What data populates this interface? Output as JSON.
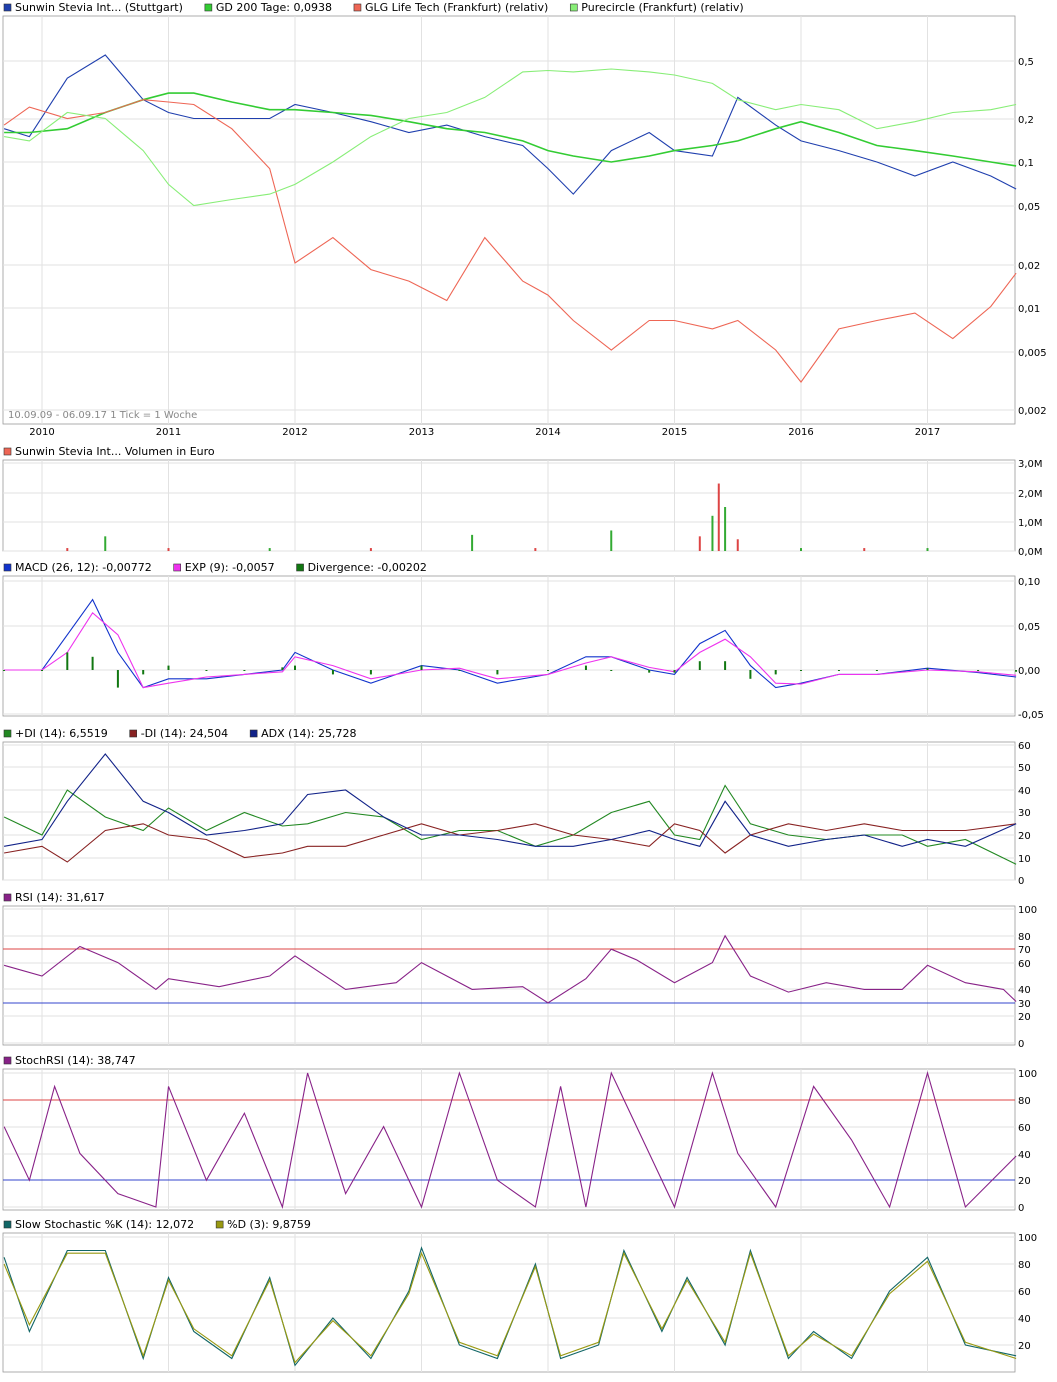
{
  "x_years": [
    "2010",
    "2011",
    "2012",
    "2013",
    "2014",
    "2015",
    "2016",
    "2017"
  ],
  "range_note": "10.09.09 - 06.09.17   1 Tick = 1 Woche",
  "colors": {
    "sunwin": "#1f3fae",
    "gd200": "#33cc33",
    "glg": "#ee6655",
    "pure": "#88ee77",
    "vol": "#dd4444",
    "vol_green": "#33aa33",
    "macd": "#1133cc",
    "exp": "#ee33ee",
    "div": "#117711",
    "pdi": "#228822",
    "mdi": "#882222",
    "adx": "#112288",
    "rsi": "#882288",
    "stoch_k": "#116666",
    "stoch_d": "#999911",
    "line_high": "#dd4444",
    "line_low": "#3344cc",
    "fill_high": "#ee5566",
    "fill_low": "#5555ee"
  },
  "panels": [
    {
      "id": "price",
      "legend": [
        {
          "label": "Sunwin Stevia Int... (Stuttgart)",
          "color": "#1f3fae"
        },
        {
          "label": "GD 200 Tage: 0,0938",
          "color": "#33cc33"
        },
        {
          "label": "GLG Life Tech (Frankfurt) (relativ)",
          "color": "#ee6655"
        },
        {
          "label": "Purecircle (Frankfurt) (relativ)",
          "color": "#88ee77"
        }
      ],
      "ticks": [
        "0,5",
        "0,2",
        "0,1",
        "0,05",
        "0,02",
        "0,01",
        "0,005",
        "0,002"
      ]
    },
    {
      "id": "volume",
      "legend": [
        {
          "label": "Sunwin Stevia Int... Volumen in Euro",
          "color": "#ee6655"
        }
      ],
      "ticks": [
        "3,0M",
        "2,0M",
        "1,0M",
        "0,0M"
      ]
    },
    {
      "id": "macd",
      "legend": [
        {
          "label": "MACD (26, 12): -0,00772",
          "color": "#1133cc"
        },
        {
          "label": "EXP (9): -0,0057",
          "color": "#ee33ee"
        },
        {
          "label": "Divergence: -0,00202",
          "color": "#117711"
        }
      ],
      "ticks": [
        "0,10",
        "0,05",
        "0,00",
        "-0,05"
      ]
    },
    {
      "id": "dmi",
      "legend": [
        {
          "label": "+DI (14): 6,5519",
          "color": "#228822"
        },
        {
          "label": "-DI (14): 24,504",
          "color": "#882222"
        },
        {
          "label": "ADX (14): 25,728",
          "color": "#112288"
        }
      ],
      "ticks": [
        "60",
        "50",
        "40",
        "30",
        "20",
        "10",
        "0"
      ]
    },
    {
      "id": "rsi",
      "legend": [
        {
          "label": "RSI (14): 31,617",
          "color": "#882288"
        }
      ],
      "ticks": [
        "100",
        "80",
        "60",
        "40",
        "20",
        "0"
      ],
      "marks": [
        "70",
        "30"
      ]
    },
    {
      "id": "stochrsi",
      "legend": [
        {
          "label": "StochRSI (14): 38,747",
          "color": "#882288"
        }
      ],
      "ticks": [
        "100",
        "60",
        "40",
        "0"
      ],
      "marks": [
        "80",
        "20"
      ]
    },
    {
      "id": "stoch",
      "legend": [
        {
          "label": "Slow Stochastic %K (14): 12,072",
          "color": "#116666"
        },
        {
          "label": "%D (3): 9,8759",
          "color": "#999911"
        }
      ],
      "ticks": [
        "100",
        "80",
        "60",
        "40",
        "20"
      ]
    }
  ],
  "chart_data": [
    {
      "type": "line",
      "title": "",
      "y_scale": "log",
      "ylim": [
        0.002,
        0.7
      ],
      "x": [
        2009.7,
        2009.9,
        2010.2,
        2010.5,
        2010.8,
        2011.0,
        2011.2,
        2011.5,
        2011.8,
        2012.0,
        2012.3,
        2012.6,
        2012.9,
        2013.2,
        2013.5,
        2013.8,
        2014.0,
        2014.2,
        2014.5,
        2014.8,
        2015.0,
        2015.3,
        2015.5,
        2015.8,
        2016.0,
        2016.3,
        2016.6,
        2016.9,
        2017.2,
        2017.5,
        2017.7
      ],
      "series": [
        {
          "name": "Sunwin Stevia Int... (Stuttgart)",
          "values": [
            0.17,
            0.15,
            0.38,
            0.55,
            0.27,
            0.22,
            0.2,
            0.2,
            0.2,
            0.25,
            0.22,
            0.19,
            0.16,
            0.18,
            0.15,
            0.13,
            0.09,
            0.06,
            0.12,
            0.16,
            0.12,
            0.11,
            0.28,
            0.18,
            0.14,
            0.12,
            0.1,
            0.08,
            0.1,
            0.08,
            0.065
          ]
        },
        {
          "name": "GD 200 Tage: 0,0938",
          "values": [
            0.16,
            0.16,
            0.17,
            0.22,
            0.27,
            0.3,
            0.3,
            0.26,
            0.23,
            0.23,
            0.22,
            0.21,
            0.19,
            0.17,
            0.16,
            0.14,
            0.12,
            0.11,
            0.1,
            0.11,
            0.12,
            0.13,
            0.14,
            0.17,
            0.19,
            0.16,
            0.13,
            0.12,
            0.11,
            0.1,
            0.094
          ]
        },
        {
          "name": "GLG Life Tech (Frankfurt) (relativ)",
          "values": [
            0.18,
            0.24,
            0.2,
            0.22,
            0.27,
            0.26,
            0.25,
            0.17,
            0.09,
            0.02,
            0.03,
            0.018,
            0.015,
            0.011,
            0.03,
            0.015,
            0.012,
            0.008,
            0.005,
            0.008,
            0.008,
            0.007,
            0.008,
            0.005,
            0.003,
            0.007,
            0.008,
            0.009,
            0.006,
            0.01,
            0.017
          ]
        },
        {
          "name": "Purecircle (Frankfurt) (relativ)",
          "values": [
            0.15,
            0.14,
            0.22,
            0.2,
            0.12,
            0.07,
            0.05,
            0.055,
            0.06,
            0.07,
            0.1,
            0.15,
            0.2,
            0.22,
            0.28,
            0.42,
            0.43,
            0.42,
            0.44,
            0.42,
            0.4,
            0.35,
            0.27,
            0.23,
            0.25,
            0.23,
            0.17,
            0.19,
            0.22,
            0.23,
            0.25
          ]
        }
      ]
    },
    {
      "type": "bar",
      "title": "",
      "ylim": [
        0,
        3.0
      ],
      "x": [
        2010.2,
        2010.5,
        2011.0,
        2011.8,
        2012.6,
        2013.4,
        2013.9,
        2014.5,
        2015.2,
        2015.3,
        2015.35,
        2015.4,
        2015.5,
        2016.0,
        2016.5,
        2017.0
      ],
      "values": [
        0.1,
        0.5,
        0.1,
        0.1,
        0.1,
        0.55,
        0.1,
        0.7,
        0.5,
        1.2,
        2.3,
        1.5,
        0.4,
        0.1,
        0.1,
        0.1
      ]
    },
    {
      "type": "line",
      "title": "",
      "ylim": [
        -0.05,
        0.11
      ],
      "x": [
        2009.7,
        2010.0,
        2010.2,
        2010.4,
        2010.6,
        2010.8,
        2011.0,
        2011.3,
        2011.6,
        2011.9,
        2012.0,
        2012.3,
        2012.6,
        2013.0,
        2013.3,
        2013.6,
        2014.0,
        2014.3,
        2014.5,
        2014.8,
        2015.0,
        2015.2,
        2015.4,
        2015.6,
        2015.8,
        2016.0,
        2016.3,
        2016.6,
        2017.0,
        2017.4,
        2017.7
      ],
      "series": [
        {
          "name": "MACD (26, 12): -0,00772",
          "values": [
            0.0,
            0.0,
            0.04,
            0.08,
            0.02,
            -0.02,
            -0.01,
            -0.01,
            -0.005,
            0.0,
            0.02,
            0.0,
            -0.015,
            0.005,
            0.0,
            -0.015,
            -0.005,
            0.015,
            0.015,
            0.0,
            -0.005,
            0.03,
            0.045,
            0.005,
            -0.02,
            -0.015,
            -0.005,
            -0.005,
            0.002,
            -0.003,
            -0.008
          ]
        },
        {
          "name": "EXP (9): -0,0057",
          "values": [
            0.0,
            0.0,
            0.02,
            0.065,
            0.04,
            -0.02,
            -0.015,
            -0.008,
            -0.005,
            -0.002,
            0.015,
            0.005,
            -0.01,
            0.0,
            0.002,
            -0.01,
            -0.005,
            0.008,
            0.015,
            0.003,
            -0.002,
            0.02,
            0.035,
            0.015,
            -0.015,
            -0.016,
            -0.005,
            -0.005,
            0.0,
            -0.002,
            -0.006
          ]
        },
        {
          "name": "Divergence: -0,00202",
          "values": [
            0.0,
            0.0,
            0.02,
            0.015,
            -0.02,
            -0.005,
            0.005,
            0.0,
            0.0,
            0.003,
            0.005,
            -0.005,
            -0.005,
            0.005,
            0.0,
            -0.005,
            0.0,
            0.005,
            0.0,
            -0.003,
            -0.003,
            0.01,
            0.01,
            -0.01,
            -0.005,
            0.0,
            0.0,
            0.0,
            0.002,
            -0.001,
            -0.002
          ]
        }
      ]
    },
    {
      "type": "line",
      "title": "",
      "ylim": [
        0,
        60
      ],
      "x": [
        2009.7,
        2010.0,
        2010.2,
        2010.5,
        2010.8,
        2011.0,
        2011.3,
        2011.6,
        2011.9,
        2012.1,
        2012.4,
        2012.7,
        2013.0,
        2013.3,
        2013.6,
        2013.9,
        2014.2,
        2014.5,
        2014.8,
        2015.0,
        2015.2,
        2015.4,
        2015.6,
        2015.9,
        2016.2,
        2016.5,
        2016.8,
        2017.0,
        2017.3,
        2017.7
      ],
      "series": [
        {
          "name": "+DI (14): 6,5519",
          "values": [
            28,
            20,
            40,
            28,
            22,
            32,
            22,
            30,
            24,
            25,
            30,
            28,
            18,
            22,
            22,
            15,
            20,
            30,
            35,
            20,
            18,
            42,
            25,
            20,
            18,
            20,
            20,
            15,
            18,
            7
          ]
        },
        {
          "name": "-DI (14): 24,504",
          "values": [
            12,
            15,
            8,
            22,
            25,
            20,
            18,
            10,
            12,
            15,
            15,
            20,
            25,
            20,
            22,
            25,
            20,
            18,
            15,
            25,
            22,
            12,
            20,
            25,
            22,
            25,
            22,
            22,
            22,
            25
          ]
        },
        {
          "name": "ADX (14): 25,728",
          "values": [
            15,
            18,
            35,
            56,
            35,
            30,
            20,
            22,
            25,
            38,
            40,
            28,
            20,
            20,
            18,
            15,
            15,
            18,
            22,
            18,
            15,
            35,
            20,
            15,
            18,
            20,
            15,
            18,
            15,
            25
          ]
        }
      ]
    },
    {
      "type": "line",
      "title": "",
      "ylim": [
        0,
        100
      ],
      "x": [
        2009.7,
        2010.0,
        2010.3,
        2010.6,
        2010.9,
        2011.0,
        2011.4,
        2011.8,
        2012.0,
        2012.4,
        2012.8,
        2013.0,
        2013.4,
        2013.8,
        2014.0,
        2014.3,
        2014.5,
        2014.7,
        2015.0,
        2015.3,
        2015.4,
        2015.6,
        2015.9,
        2016.2,
        2016.5,
        2016.8,
        2017.0,
        2017.3,
        2017.6,
        2017.7
      ],
      "series": [
        {
          "name": "RSI (14): 31,617",
          "values": [
            58,
            50,
            72,
            60,
            40,
            48,
            42,
            50,
            65,
            40,
            45,
            60,
            40,
            42,
            30,
            48,
            70,
            62,
            45,
            60,
            80,
            50,
            38,
            45,
            40,
            40,
            58,
            45,
            40,
            31
          ]
        }
      ]
    },
    {
      "type": "line",
      "title": "",
      "ylim": [
        0,
        100
      ],
      "x": [
        2009.7,
        2009.9,
        2010.1,
        2010.3,
        2010.6,
        2010.9,
        2011.0,
        2011.3,
        2011.6,
        2011.9,
        2012.1,
        2012.4,
        2012.7,
        2013.0,
        2013.3,
        2013.6,
        2013.9,
        2014.1,
        2014.3,
        2014.5,
        2014.7,
        2015.0,
        2015.3,
        2015.5,
        2015.8,
        2016.1,
        2016.4,
        2016.7,
        2017.0,
        2017.3,
        2017.7
      ],
      "series": [
        {
          "name": "StochRSI (14): 38,747",
          "values": [
            60,
            20,
            90,
            40,
            10,
            0,
            90,
            20,
            70,
            0,
            100,
            10,
            60,
            0,
            100,
            20,
            0,
            90,
            0,
            100,
            60,
            0,
            100,
            40,
            0,
            90,
            50,
            0,
            100,
            0,
            38
          ]
        }
      ]
    },
    {
      "type": "line",
      "title": "",
      "ylim": [
        0,
        100
      ],
      "x": [
        2009.7,
        2009.9,
        2010.2,
        2010.5,
        2010.8,
        2011.0,
        2011.2,
        2011.5,
        2011.8,
        2012.0,
        2012.3,
        2012.6,
        2012.9,
        2013.0,
        2013.3,
        2013.6,
        2013.9,
        2014.1,
        2014.4,
        2014.6,
        2014.9,
        2015.1,
        2015.4,
        2015.6,
        2015.9,
        2016.1,
        2016.4,
        2016.7,
        2017.0,
        2017.3,
        2017.7
      ],
      "series": [
        {
          "name": "Slow Stochastic %K (14): 12,072",
          "values": [
            85,
            30,
            90,
            90,
            10,
            70,
            30,
            10,
            70,
            5,
            40,
            10,
            60,
            92,
            20,
            10,
            80,
            10,
            20,
            90,
            30,
            70,
            20,
            90,
            10,
            30,
            10,
            60,
            85,
            20,
            12
          ]
        },
        {
          "name": "%D (3): 9,8759",
          "values": [
            80,
            35,
            88,
            88,
            12,
            68,
            32,
            12,
            68,
            7,
            38,
            12,
            58,
            88,
            22,
            12,
            78,
            12,
            22,
            88,
            32,
            68,
            22,
            88,
            12,
            28,
            12,
            58,
            82,
            22,
            10
          ]
        }
      ]
    }
  ]
}
